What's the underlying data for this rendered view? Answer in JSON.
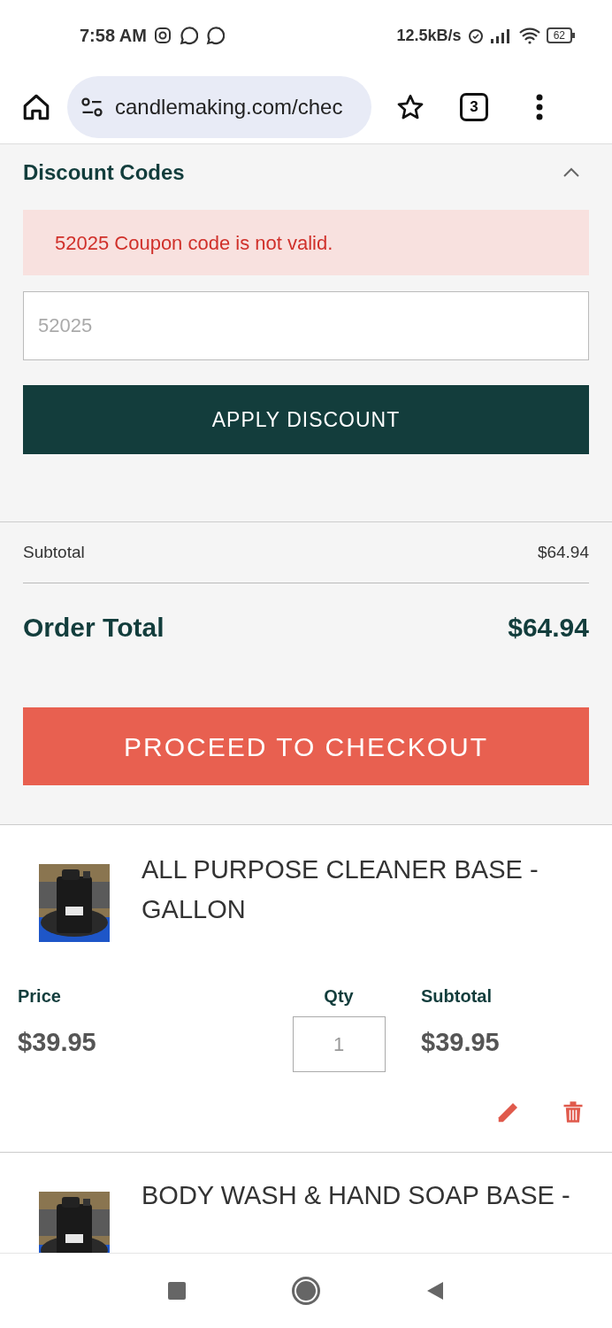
{
  "status_bar": {
    "time": "7:58 AM",
    "speed": "12.5kB/s",
    "battery": "62"
  },
  "browser": {
    "url": "candlemaking.com/chec",
    "tab_count": "3"
  },
  "discount": {
    "title": "Discount Codes",
    "expanded": true,
    "error": "52025 Coupon code is not valid.",
    "placeholder": "52025",
    "button": "APPLY DISCOUNT"
  },
  "totals": {
    "subtotal_label": "Subtotal",
    "subtotal": "$64.94",
    "total_label": "Order Total",
    "total": "$64.94"
  },
  "checkout_button": "PROCEED TO CHECKOUT",
  "items": [
    {
      "name": "ALL PURPOSE CLEANER BASE - GALLON",
      "price_label": "Price",
      "price": "$39.95",
      "qty_label": "Qty",
      "qty": "1",
      "subtotal_label": "Subtotal",
      "subtotal": "$39.95"
    },
    {
      "name": "BODY WASH & HAND SOAP BASE -"
    }
  ]
}
